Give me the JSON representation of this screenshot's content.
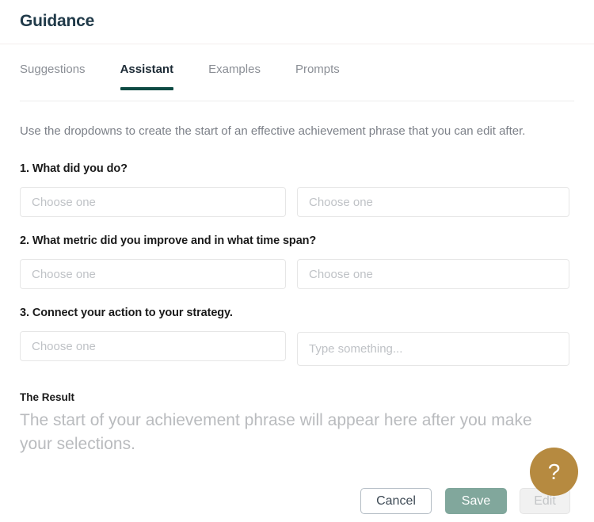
{
  "header": {
    "title": "Guidance"
  },
  "tabs": [
    {
      "label": "Suggestions",
      "active": false
    },
    {
      "label": "Assistant",
      "active": true
    },
    {
      "label": "Examples",
      "active": false
    },
    {
      "label": "Prompts",
      "active": false
    }
  ],
  "main": {
    "intro": "Use the dropdowns to create the start of an effective achievement phrase that you can edit after.",
    "questions": [
      {
        "label": "1. What did you do?",
        "left": {
          "value": "",
          "placeholder": "Choose one"
        },
        "right": {
          "value": "",
          "placeholder": "Choose one"
        }
      },
      {
        "label": "2. What metric did you improve and in what time span?",
        "left": {
          "value": "",
          "placeholder": "Choose one"
        },
        "right": {
          "value": "",
          "placeholder": "Choose one"
        }
      },
      {
        "label": "3. Connect your action to your strategy.",
        "left": {
          "value": "",
          "placeholder": "Choose one"
        },
        "right": {
          "value": "",
          "placeholder": "Type something..."
        }
      }
    ],
    "result": {
      "label": "The Result",
      "placeholder": "The start of your achievement phrase will appear here after you make your selections."
    }
  },
  "footer": {
    "cancel_label": "Cancel",
    "save_label": "Save",
    "edit_label": "Edit"
  },
  "help": {
    "icon": "question-mark-icon",
    "glyph": "?"
  },
  "colors": {
    "title": "#203a49",
    "tab_active_underline": "#0d4a43",
    "save_button": "#81a79c",
    "help_button": "#b68a40",
    "placeholder_text": "#bfc2c6",
    "muted_text": "#7c8088"
  }
}
